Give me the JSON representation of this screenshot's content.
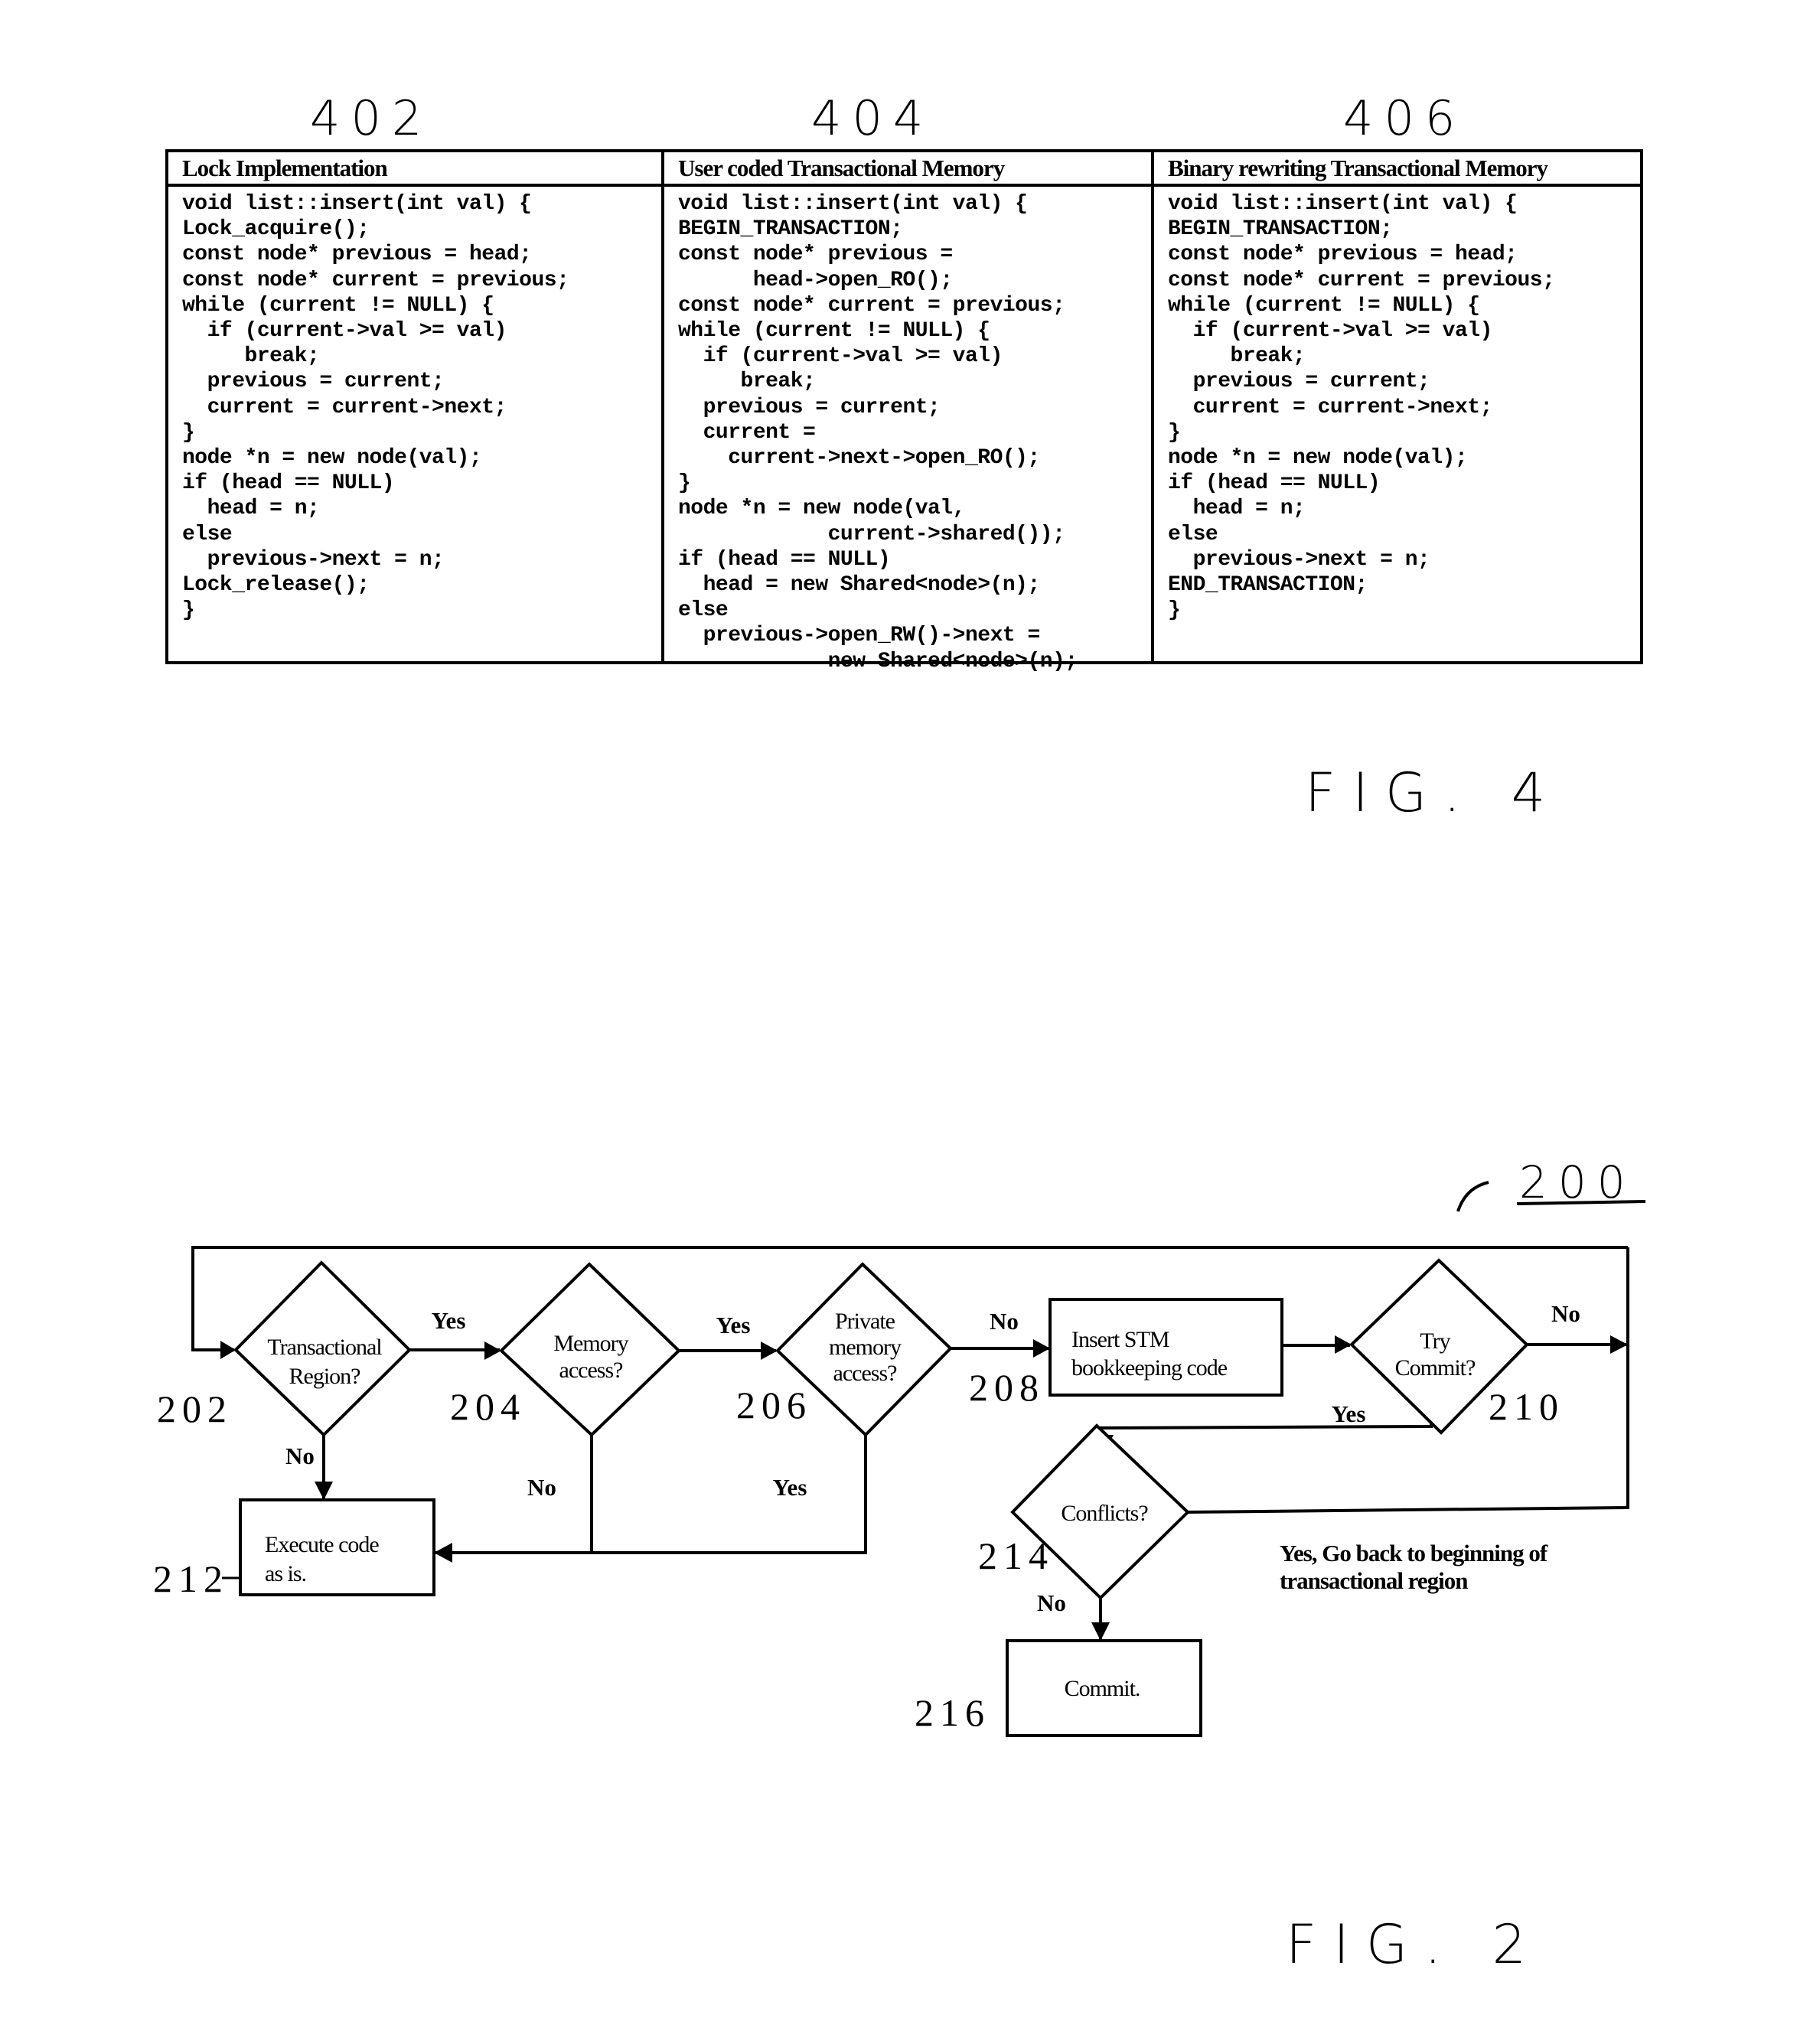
{
  "fig4": {
    "label": "FIG. 4",
    "columns": [
      {
        "ref": "402",
        "header": "Lock Implementation",
        "code": [
          "void list::insert(int val) {",
          "Lock_acquire();",
          "const node* previous = head;",
          "const node* current = previous;",
          "while (current != NULL) {",
          "  if (current->val >= val)",
          "     break;",
          "  previous = current;",
          "  current = current->next;",
          "}",
          "node *n = new node(val);",
          "if (head == NULL)",
          "  head = n;",
          "else",
          "  previous->next = n;",
          "Lock_release();",
          "}"
        ]
      },
      {
        "ref": "404",
        "header": "User coded Transactional Memory",
        "code": [
          "void list::insert(int val) {",
          "BEGIN_TRANSACTION;",
          "const node* previous =",
          "      head->open_RO();",
          "const node* current = previous;",
          "while (current != NULL) {",
          "  if (current->val >= val)",
          "     break;",
          "  previous = current;",
          "  current =",
          "    current->next->open_RO();",
          "}",
          "node *n = new node(val,",
          "            current->shared());",
          "if (head == NULL)",
          "  head = new Shared<node>(n);",
          "else",
          "  previous->open_RW()->next =",
          "            new Shared<node>(n);"
        ]
      },
      {
        "ref": "406",
        "header": "Binary rewriting Transactional Memory",
        "code": [
          "void list::insert(int val) {",
          "BEGIN_TRANSACTION;",
          "const node* previous = head;",
          "const node* current = previous;",
          "while (current != NULL) {",
          "  if (current->val >= val)",
          "     break;",
          "  previous = current;",
          "  current = current->next;",
          "}",
          "node *n = new node(val);",
          "if (head == NULL)",
          "  head = n;",
          "else",
          "  previous->next = n;",
          "END_TRANSACTION;",
          "}"
        ]
      }
    ]
  },
  "fig2": {
    "label": "FIG. 2",
    "ref": "200",
    "nodes": {
      "n202": {
        "ref": "202",
        "lines": [
          "Transactional",
          "Region?"
        ]
      },
      "n204": {
        "ref": "204",
        "lines": [
          "Memory",
          "access?"
        ]
      },
      "n206": {
        "ref": "206",
        "lines": [
          "Private",
          "memory",
          "access?"
        ]
      },
      "n208": {
        "ref": "208",
        "lines": [
          "Insert STM",
          "bookkeeping code"
        ]
      },
      "n210": {
        "ref": "210",
        "lines": [
          "Try",
          "Commit?"
        ]
      },
      "n212": {
        "ref": "212",
        "lines": [
          "Execute code",
          "as is."
        ]
      },
      "n214": {
        "ref": "214",
        "lines": [
          "Conflicts?"
        ]
      },
      "n216": {
        "ref": "216",
        "lines": [
          "Commit."
        ]
      }
    },
    "edge_labels": {
      "e202_204": "Yes",
      "e202_212": "No",
      "e204_206": "Yes",
      "e204_212": "No",
      "e206_208": "No",
      "e206_212": "Yes",
      "e210_loop": "No",
      "e210_214": "Yes",
      "e214_216": "No"
    },
    "note": [
      "Yes, Go back  to beginning of",
      "transactional region"
    ]
  }
}
